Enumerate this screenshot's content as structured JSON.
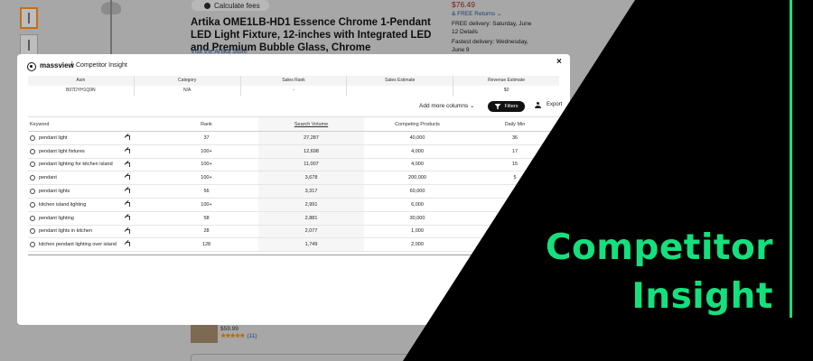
{
  "background_page": {
    "calc_button": "Calculate fees",
    "product_title": "Artika OME1LB-HD1 Essence Chrome 1-Pendant LED Light Fixture, 12-inches with Integrated LED and Premium Bubble Glass, Chrome",
    "store_link": "Visit the Artika Store",
    "price": "$76.49",
    "returns": "& FREE Returns ⌄",
    "free_delivery": "FREE delivery: Saturday, June 12 Details",
    "fastest_delivery": "Fastest delivery: Wednesday, June 9",
    "related_price": "$59.99",
    "related_stars": "★★★★★",
    "related_reviews": "(11)"
  },
  "modal": {
    "brand": "massview",
    "separator": "|",
    "subtitle": "Competitor Insight",
    "close": "×",
    "summary": {
      "headers": [
        "Asin",
        "Category",
        "Sales Rank",
        "Sales Estimate",
        "Revenue Estimate"
      ],
      "values": [
        "B07DYH1Q9N",
        "N/A",
        "-",
        "",
        "$0"
      ]
    },
    "toolbar": {
      "add_columns": "Add more columns ⌄",
      "filters": "Filters",
      "export": "Export"
    },
    "table": {
      "headers": {
        "keyword": "Keyword",
        "rank": "Rank",
        "volume": "Search Volume",
        "competing": "Competing Products",
        "daily": "Daily Min"
      },
      "rows": [
        {
          "keyword": "pendant light",
          "rank": "37",
          "volume": "27,287",
          "competing": "40,000",
          "daily": "36"
        },
        {
          "keyword": "pendant light fixtures",
          "rank": "100+",
          "volume": "12,698",
          "competing": "4,000",
          "daily": "17"
        },
        {
          "keyword": "pendant lighting for kitchen island",
          "rank": "100+",
          "volume": "11,007",
          "competing": "4,000",
          "daily": "15"
        },
        {
          "keyword": "pendant",
          "rank": "100+",
          "volume": "3,678",
          "competing": "200,000",
          "daily": "5"
        },
        {
          "keyword": "pendant lights",
          "rank": "56",
          "volume": "3,317",
          "competing": "60,000",
          "daily": "4"
        },
        {
          "keyword": "kitchen island lighting",
          "rank": "100+",
          "volume": "2,991",
          "competing": "6,000",
          "daily": ""
        },
        {
          "keyword": "pendant lighting",
          "rank": "58",
          "volume": "2,881",
          "competing": "30,000",
          "daily": ""
        },
        {
          "keyword": "pendant lights in kitchen",
          "rank": "28",
          "volume": "2,077",
          "competing": "1,000",
          "daily": ""
        },
        {
          "keyword": "kitchen pendant lighting over island",
          "rank": "128",
          "volume": "1,749",
          "competing": "2,000",
          "daily": ""
        }
      ]
    }
  },
  "banner": {
    "line1": "Competitor",
    "line2": "Insight",
    "accent_color": "#14e07d"
  }
}
